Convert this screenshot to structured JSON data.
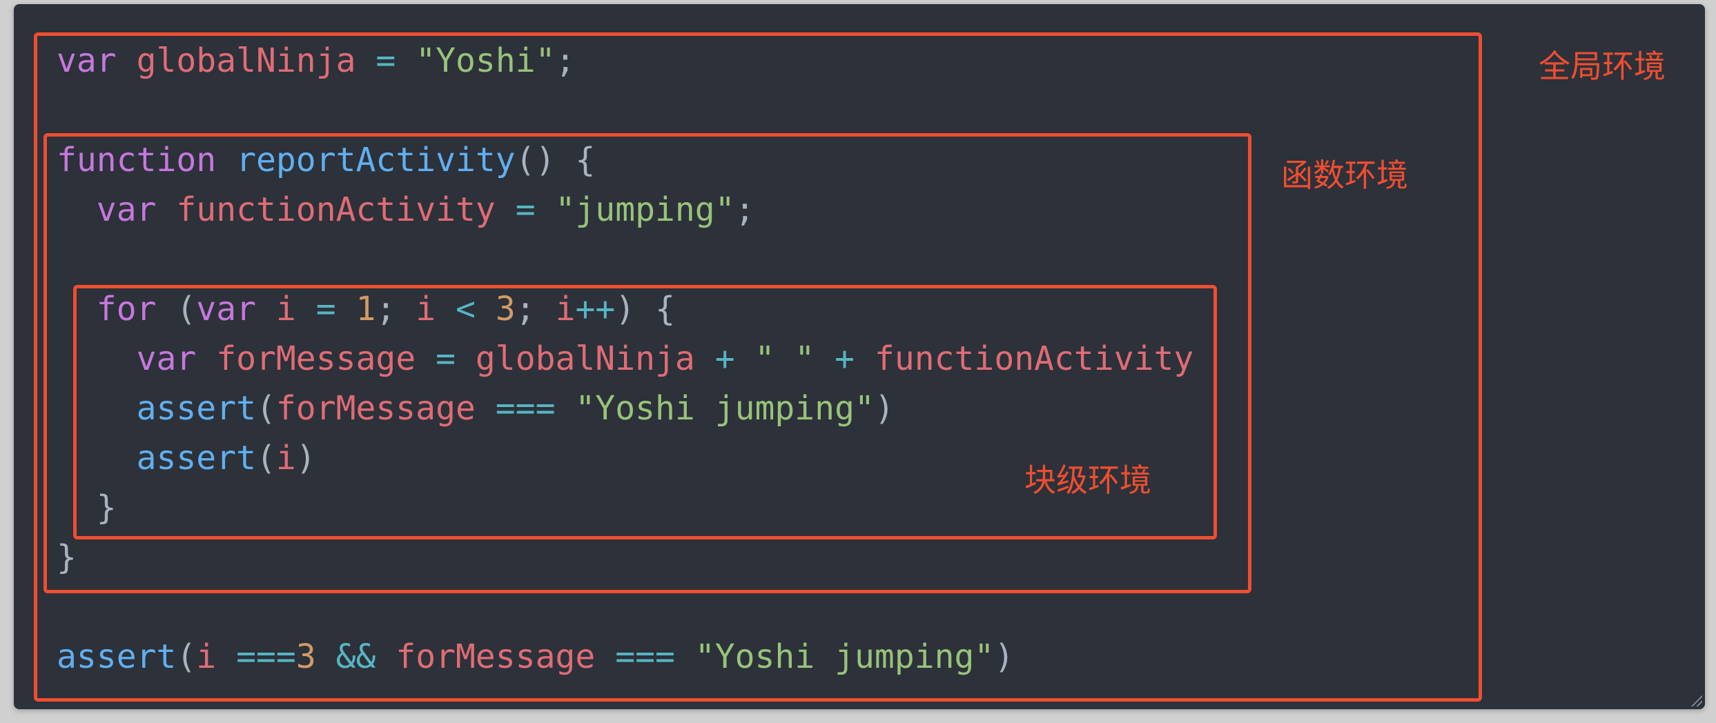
{
  "code_lines": [
    [
      [
        "kw",
        "var"
      ],
      [
        "pun",
        " "
      ],
      [
        "var",
        "globalNinja"
      ],
      [
        "pun",
        " "
      ],
      [
        "op",
        "="
      ],
      [
        "pun",
        " "
      ],
      [
        "str",
        "\"Yoshi\""
      ],
      [
        "pun",
        ";"
      ]
    ],
    [],
    [
      [
        "kw",
        "function"
      ],
      [
        "pun",
        " "
      ],
      [
        "fn",
        "reportActivity"
      ],
      [
        "pun",
        "() {"
      ]
    ],
    [
      [
        "pun",
        "  "
      ],
      [
        "kw",
        "var"
      ],
      [
        "pun",
        " "
      ],
      [
        "var",
        "functionActivity"
      ],
      [
        "pun",
        " "
      ],
      [
        "op",
        "="
      ],
      [
        "pun",
        " "
      ],
      [
        "str",
        "\"jumping\""
      ],
      [
        "pun",
        ";"
      ]
    ],
    [],
    [
      [
        "pun",
        "  "
      ],
      [
        "kw",
        "for"
      ],
      [
        "pun",
        " ("
      ],
      [
        "kw",
        "var"
      ],
      [
        "pun",
        " "
      ],
      [
        "var",
        "i"
      ],
      [
        "pun",
        " "
      ],
      [
        "op",
        "="
      ],
      [
        "pun",
        " "
      ],
      [
        "num",
        "1"
      ],
      [
        "pun",
        "; "
      ],
      [
        "var",
        "i"
      ],
      [
        "pun",
        " "
      ],
      [
        "op",
        "<"
      ],
      [
        "pun",
        " "
      ],
      [
        "num",
        "3"
      ],
      [
        "pun",
        "; "
      ],
      [
        "var",
        "i"
      ],
      [
        "op",
        "++"
      ],
      [
        "pun",
        ") {"
      ]
    ],
    [
      [
        "pun",
        "    "
      ],
      [
        "kw",
        "var"
      ],
      [
        "pun",
        " "
      ],
      [
        "var",
        "forMessage"
      ],
      [
        "pun",
        " "
      ],
      [
        "op",
        "="
      ],
      [
        "pun",
        " "
      ],
      [
        "var",
        "globalNinja"
      ],
      [
        "pun",
        " "
      ],
      [
        "op",
        "+"
      ],
      [
        "pun",
        " "
      ],
      [
        "str",
        "\" \""
      ],
      [
        "pun",
        " "
      ],
      [
        "op",
        "+"
      ],
      [
        "pun",
        " "
      ],
      [
        "var",
        "functionActivity"
      ]
    ],
    [
      [
        "pun",
        "    "
      ],
      [
        "fn",
        "assert"
      ],
      [
        "pun",
        "("
      ],
      [
        "var",
        "forMessage"
      ],
      [
        "pun",
        " "
      ],
      [
        "op",
        "==="
      ],
      [
        "pun",
        " "
      ],
      [
        "str",
        "\"Yoshi jumping\""
      ],
      [
        "pun",
        ")"
      ]
    ],
    [
      [
        "pun",
        "    "
      ],
      [
        "fn",
        "assert"
      ],
      [
        "pun",
        "("
      ],
      [
        "var",
        "i"
      ],
      [
        "pun",
        ")"
      ]
    ],
    [
      [
        "pun",
        "  }"
      ]
    ],
    [
      [
        "pun",
        "}"
      ]
    ],
    [],
    [
      [
        "fn",
        "assert"
      ],
      [
        "pun",
        "("
      ],
      [
        "var",
        "i"
      ],
      [
        "pun",
        " "
      ],
      [
        "op",
        "==="
      ],
      [
        "num",
        "3"
      ],
      [
        "pun",
        " "
      ],
      [
        "op",
        "&&"
      ],
      [
        "pun",
        " "
      ],
      [
        "var",
        "forMessage"
      ],
      [
        "pun",
        " "
      ],
      [
        "op",
        "==="
      ],
      [
        "pun",
        " "
      ],
      [
        "str",
        "\"Yoshi jumping\""
      ],
      [
        "pun",
        ")"
      ]
    ]
  ],
  "scopes": {
    "global": {
      "label": "全局环境",
      "color": "#f04e30"
    },
    "function": {
      "label": "函数环境",
      "color": "#f04e30"
    },
    "block": {
      "label": "块级环境",
      "color": "#f04e30"
    }
  },
  "colors": {
    "background": "#2c313a",
    "keyword": "#c678dd",
    "variable": "#e06c75",
    "operator": "#56b6c2",
    "string": "#98c379",
    "function": "#61afef",
    "number": "#d19a66",
    "punctuation": "#abb2bf",
    "scope_border": "#f04e30"
  }
}
